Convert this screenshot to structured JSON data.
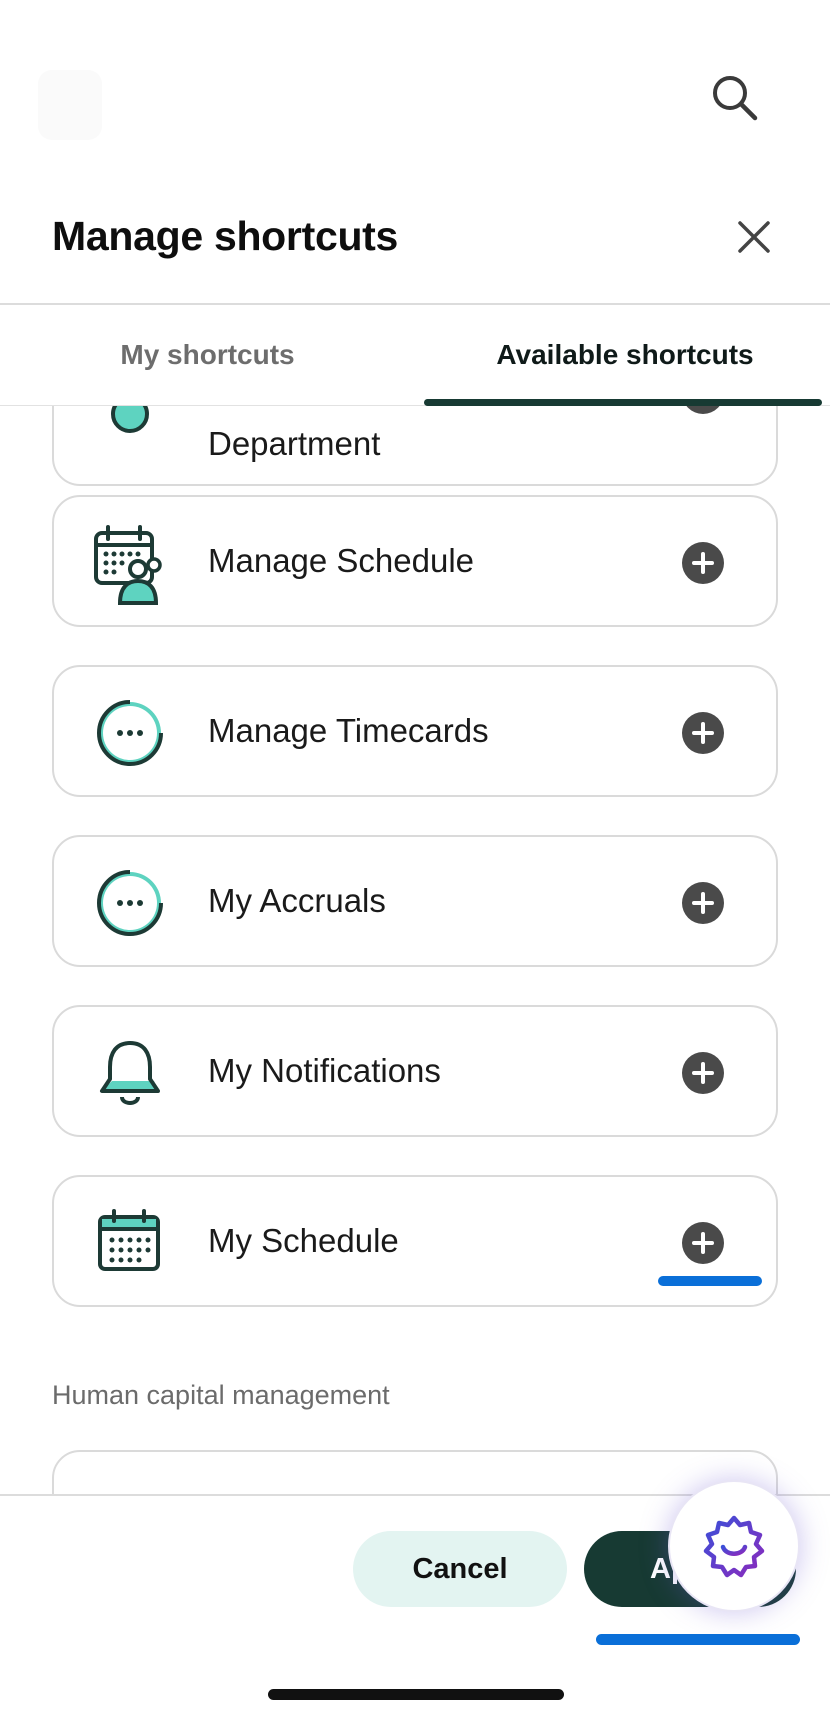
{
  "sheet": {
    "title": "Manage shortcuts"
  },
  "tabs": [
    {
      "label": "My shortcuts",
      "selected": false
    },
    {
      "label": "Available shortcuts",
      "selected": true
    }
  ],
  "shortcuts": [
    {
      "label": "Department",
      "icon": "department-icon"
    },
    {
      "label": "Manage Schedule",
      "icon": "schedule-team-icon"
    },
    {
      "label": "Manage Timecards",
      "icon": "more-circle-icon"
    },
    {
      "label": "My Accruals",
      "icon": "more-circle-icon"
    },
    {
      "label": "My Notifications",
      "icon": "bell-icon"
    },
    {
      "label": "My Schedule",
      "icon": "calendar-icon"
    }
  ],
  "section": {
    "label": "Human capital management"
  },
  "footer": {
    "cancel_label": "Cancel",
    "apply_label": "Ap"
  },
  "colors": {
    "accent_dark": "#173a33",
    "accent_teal": "#5ed3c0",
    "cancel_bg": "#e3f4f1",
    "focus_blue": "#0a6fd8"
  }
}
